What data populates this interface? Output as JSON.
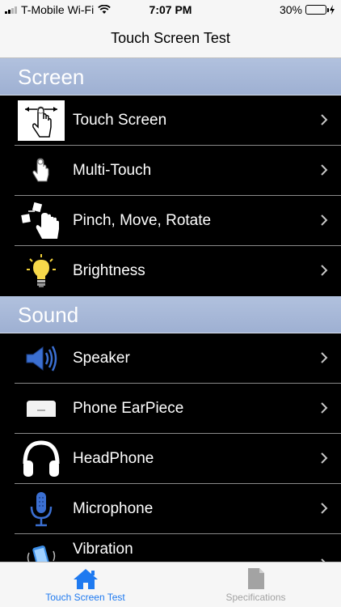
{
  "status": {
    "carrier": "T-Mobile Wi-Fi",
    "time": "7:07 PM",
    "battery": "30%",
    "battery_level": 0.3
  },
  "nav": {
    "title": "Touch Screen Test"
  },
  "sections": [
    {
      "title": "Screen",
      "items": [
        {
          "label": "Touch Screen",
          "icon": "touch-screen-icon"
        },
        {
          "label": "Multi-Touch",
          "icon": "multi-touch-icon"
        },
        {
          "label": "Pinch, Move, Rotate",
          "icon": "pinch-icon"
        },
        {
          "label": "Brightness",
          "icon": "bulb-icon"
        }
      ]
    },
    {
      "title": "Sound",
      "items": [
        {
          "label": "Speaker",
          "icon": "speaker-icon"
        },
        {
          "label": "Phone EarPiece",
          "icon": "earpiece-icon"
        },
        {
          "label": "HeadPhone",
          "icon": "headphone-icon"
        },
        {
          "label": "Microphone",
          "icon": "microphone-icon"
        },
        {
          "label": "Vibration",
          "icon": "vibration-icon"
        }
      ]
    }
  ],
  "tabs": [
    {
      "label": "Touch Screen Test",
      "icon": "home-icon",
      "active": true
    },
    {
      "label": "Specifications",
      "icon": "document-icon",
      "active": false
    }
  ],
  "colors": {
    "accent": "#1f7af0",
    "section_header": "#a8b9d8",
    "battery_fill": "#4cd964"
  }
}
